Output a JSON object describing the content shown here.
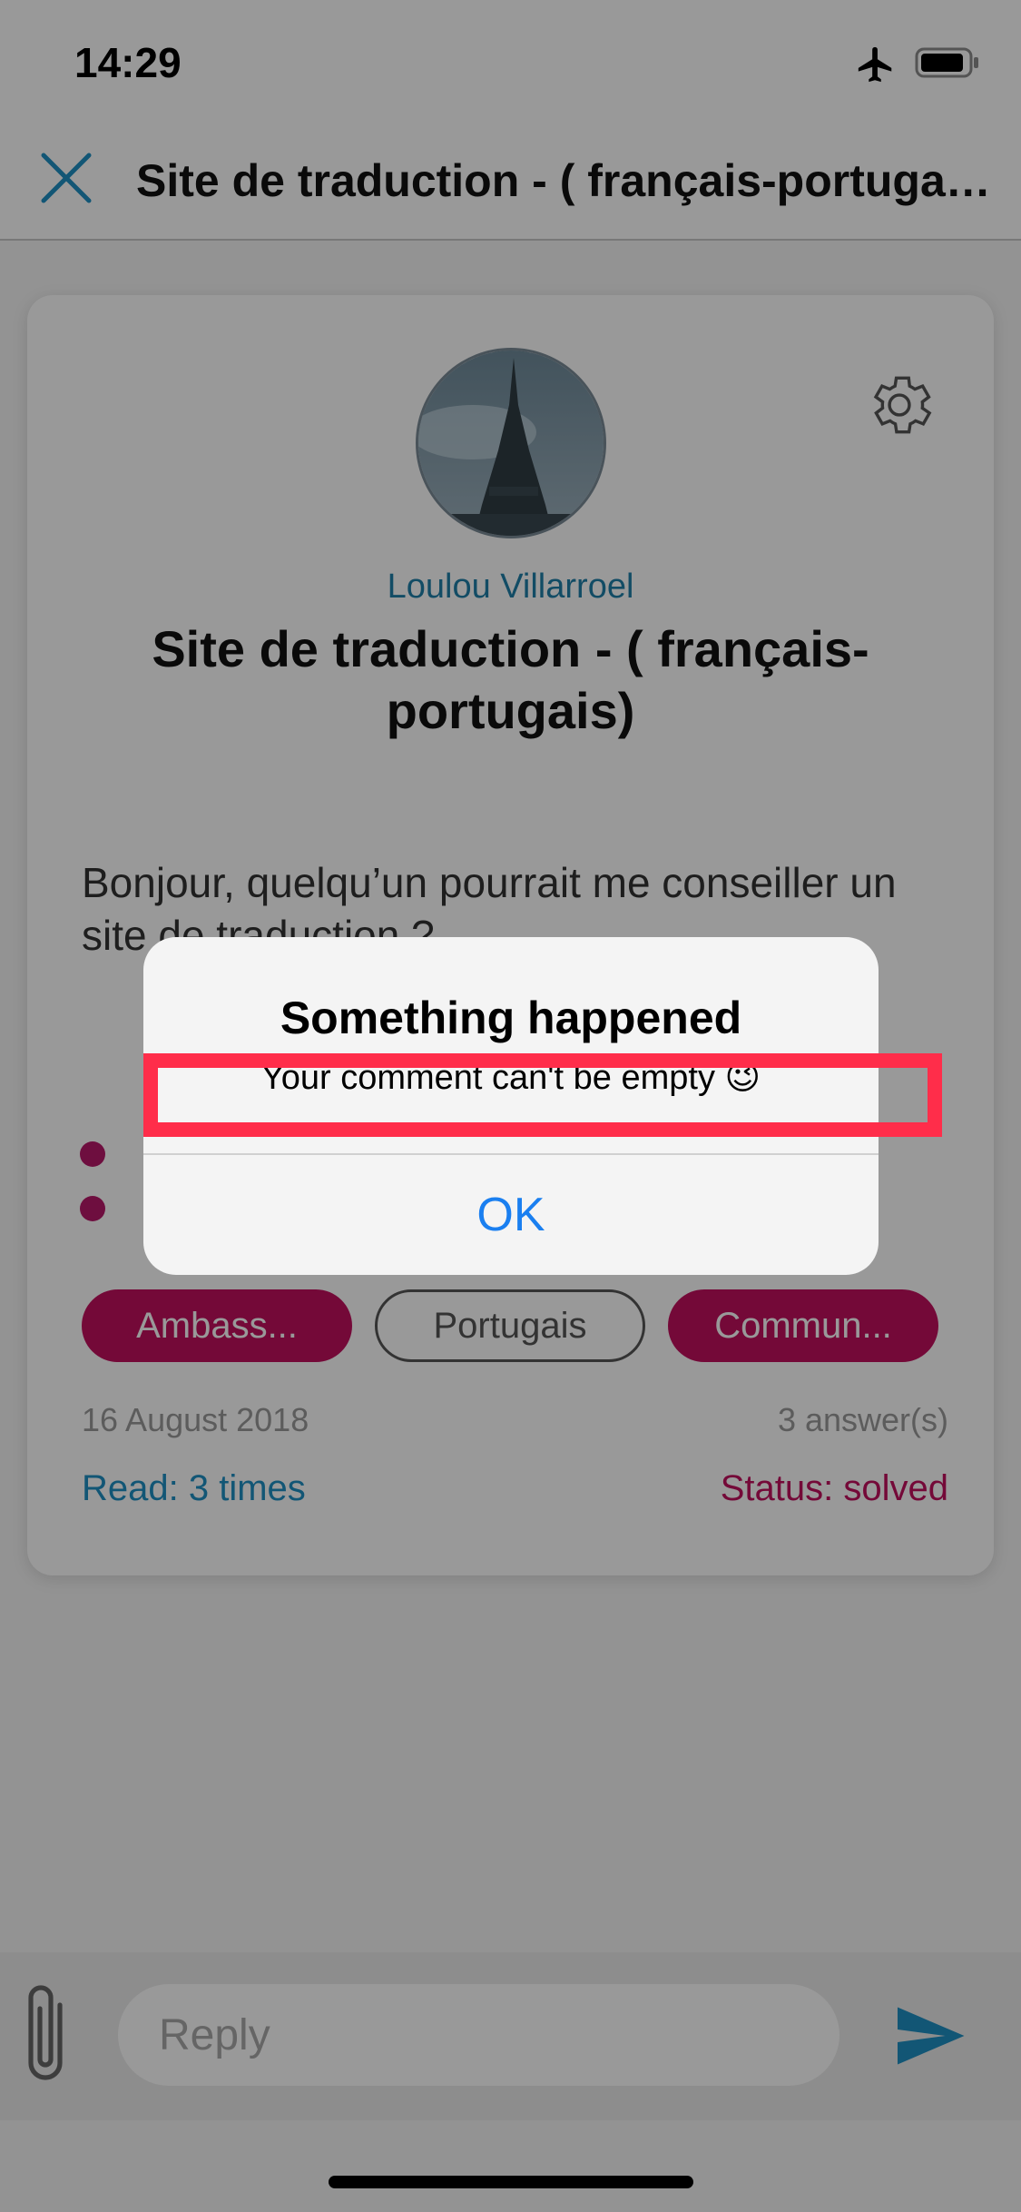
{
  "status_bar": {
    "time": "14:29"
  },
  "nav": {
    "title": "Site de traduction  - ( français-portugais)"
  },
  "post": {
    "author": "Loulou Villarroel",
    "title": "Site de traduction  - ( français-portugais)",
    "body": "Bonjour, quelqu’un pourrait me conseiller un site de traduction ?",
    "tags": [
      "Ambass...",
      "Portugais",
      "Commun..."
    ],
    "date": "16 August 2018",
    "answers": "3 answer(s)",
    "read": "Read: 3 times",
    "status": "Status: solved"
  },
  "reply": {
    "placeholder": "Reply"
  },
  "alert": {
    "title": "Something happened",
    "message": "Your comment can't be empty 😉",
    "ok_label": "OK"
  },
  "colors": {
    "accent_blue": "#1f8fc4",
    "accent_magenta": "#c2105e",
    "highlight_red": "#ff2d4a",
    "ios_blue": "#1a7ff0"
  }
}
